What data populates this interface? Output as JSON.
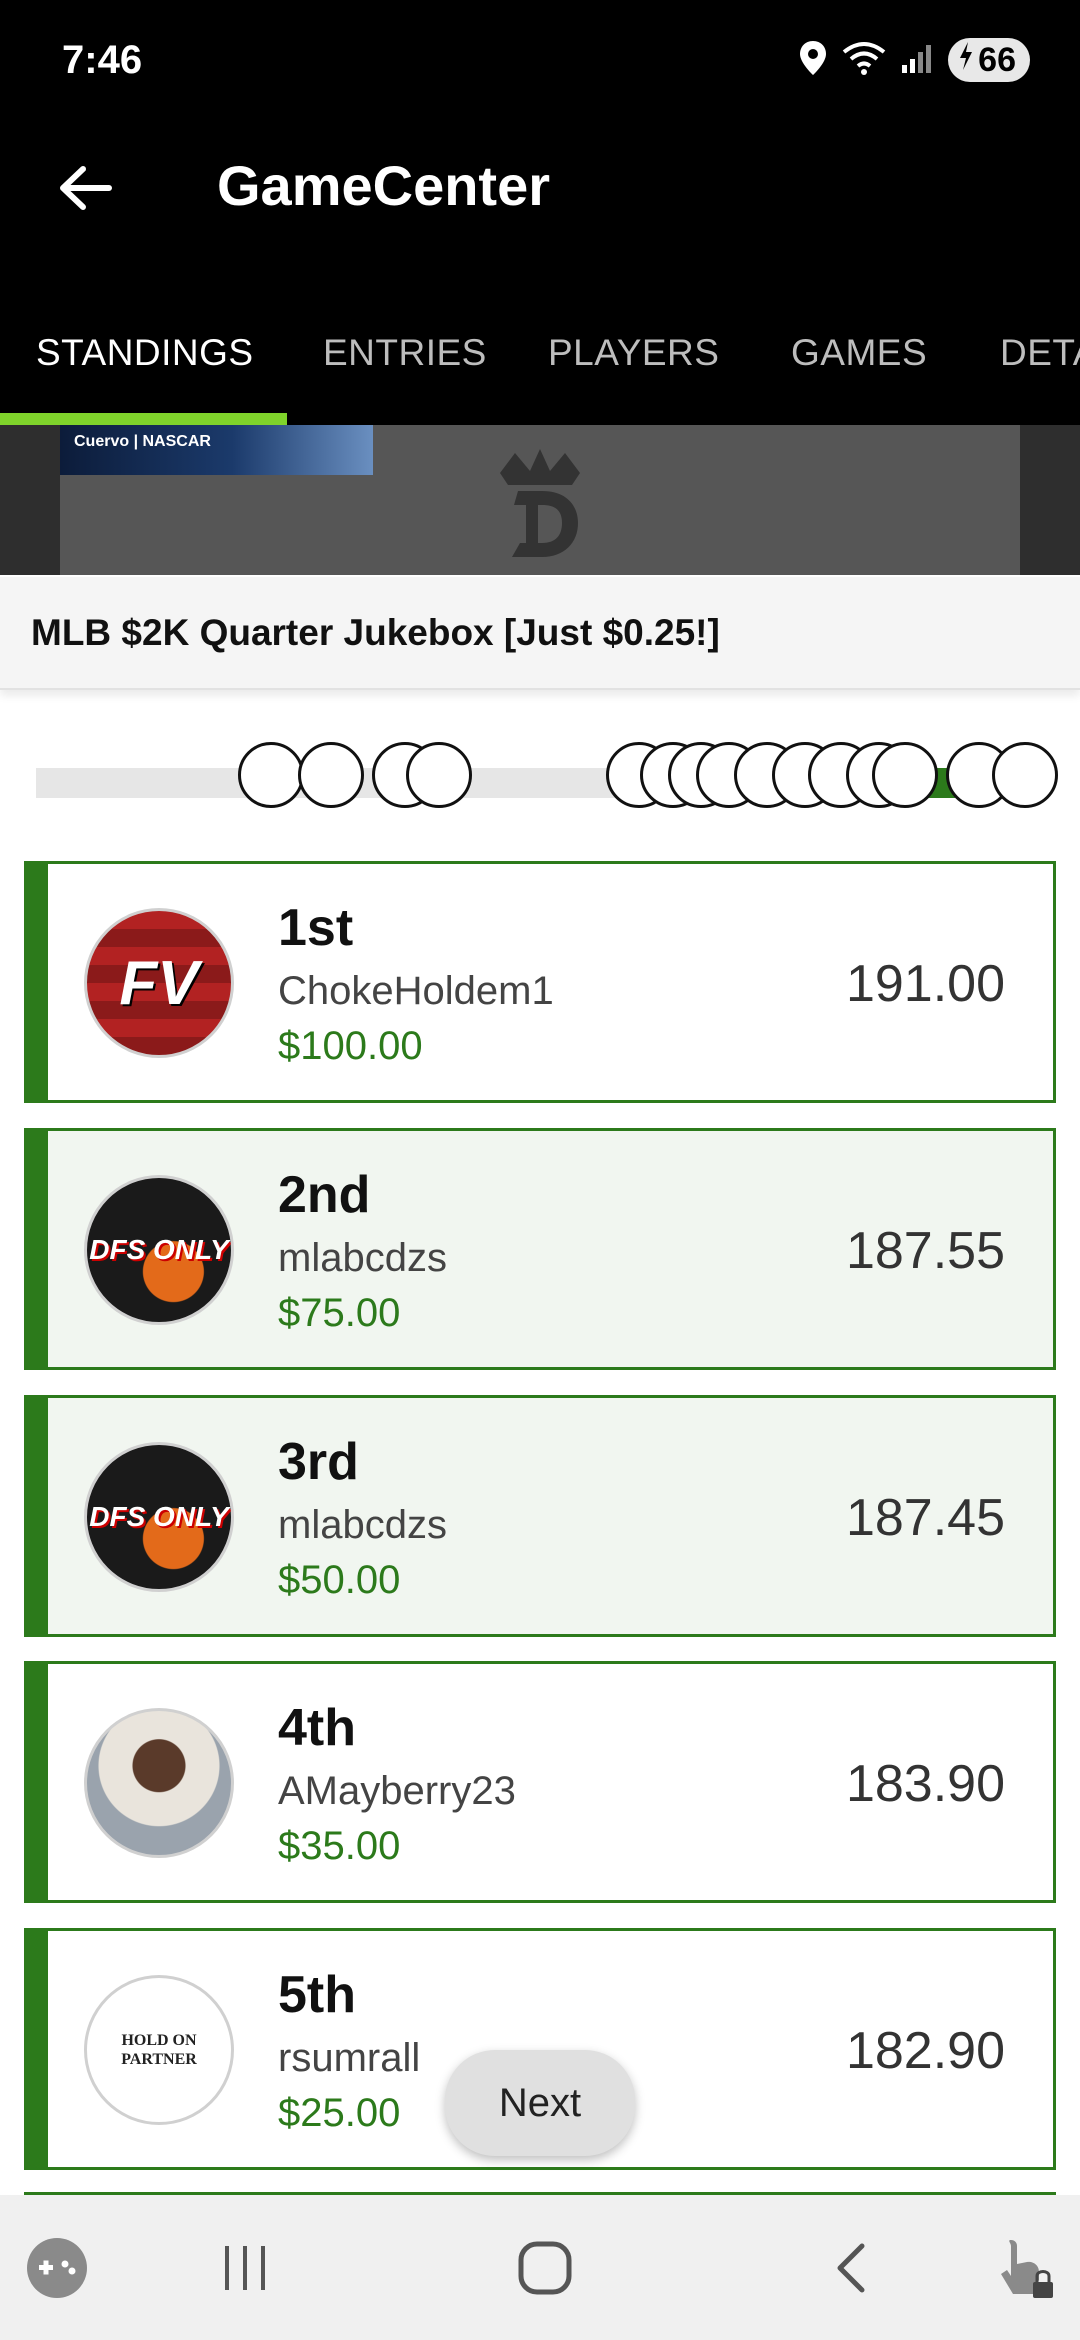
{
  "status_bar": {
    "time": "7:46",
    "battery": "66",
    "icons": [
      "location-icon",
      "wifi-icon",
      "signal-icon",
      "battery-charging-icon"
    ]
  },
  "app_bar": {
    "title": "GameCenter",
    "back_icon": "arrow-left-icon"
  },
  "tabs": [
    {
      "label": "STANDINGS",
      "active": true
    },
    {
      "label": "ENTRIES",
      "active": false
    },
    {
      "label": "PLAYERS",
      "active": false
    },
    {
      "label": "GAMES",
      "active": false
    },
    {
      "label": "DETA",
      "active": false
    }
  ],
  "ad": {
    "sponsor_text": "Cuervo | NASCAR",
    "brand_logo": "crown-d-logo"
  },
  "contest": {
    "title": "MLB $2K Quarter Jukebox [Just $0.25!]"
  },
  "standings": [
    {
      "rank": "1st",
      "username": "ChokeHoldem1",
      "prize": "$100.00",
      "score": "191.00",
      "avatar_text": "FV",
      "highlight": false
    },
    {
      "rank": "2nd",
      "username": "mlabcdzs",
      "prize": "$75.00",
      "score": "187.55",
      "avatar_text": "DFS ONLY",
      "highlight": true
    },
    {
      "rank": "3rd",
      "username": "mlabcdzs",
      "prize": "$50.00",
      "score": "187.45",
      "avatar_text": "DFS ONLY",
      "highlight": true
    },
    {
      "rank": "4th",
      "username": "AMayberry23",
      "prize": "$35.00",
      "score": "183.90",
      "avatar_text": "",
      "highlight": false
    },
    {
      "rank": "5th",
      "username": "rsumrall",
      "prize": "$25.00",
      "score": "182.90",
      "avatar_text": "HOLD ON PARTNER",
      "highlight": false
    }
  ],
  "next_button": {
    "label": "Next"
  },
  "nav_bar": {
    "icons": [
      "gamepad-icon",
      "recent-apps-icon",
      "home-icon",
      "back-icon",
      "touch-lock-icon"
    ]
  },
  "colors": {
    "accent_green": "#2c7a1b",
    "tab_indicator": "#7fd32b",
    "header_bg": "#000000"
  }
}
